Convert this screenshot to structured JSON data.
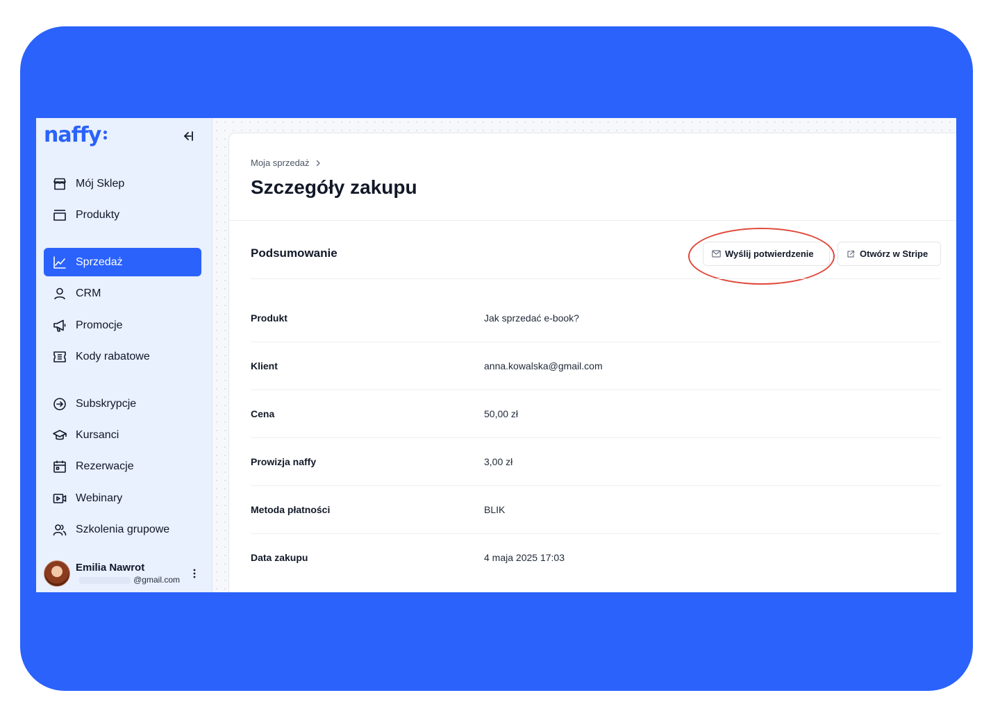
{
  "brand": {
    "logo_text": "naffy",
    "accent": "#2a62fb",
    "highlight": "#e0473a"
  },
  "sidebar": {
    "collapse_icon": "collapse-left-icon",
    "items": [
      {
        "label": "Mój Sklep",
        "icon": "store-icon",
        "active": false
      },
      {
        "label": "Produkty",
        "icon": "folder-icon",
        "active": false
      },
      {
        "label": "Sprzedaż",
        "icon": "chart-line-icon",
        "active": true
      },
      {
        "label": "CRM",
        "icon": "user-icon",
        "active": false
      },
      {
        "label": "Promocje",
        "icon": "megaphone-icon",
        "active": false
      },
      {
        "label": "Kody rabatowe",
        "icon": "ticket-icon",
        "active": false
      },
      {
        "label": "Subskrypcje",
        "icon": "subscription-icon",
        "active": false
      },
      {
        "label": "Kursanci",
        "icon": "graduation-cap-icon",
        "active": false
      },
      {
        "label": "Rezerwacje",
        "icon": "calendar-icon",
        "active": false
      },
      {
        "label": "Webinary",
        "icon": "video-icon",
        "active": false
      },
      {
        "label": "Szkolenia grupowe",
        "icon": "users-icon",
        "active": false
      }
    ],
    "user": {
      "name": "Emilia Nawrot",
      "email": "@gmail.com"
    }
  },
  "main": {
    "breadcrumb": "Moja sprzedaż",
    "title": "Szczegóły zakupu",
    "section_title": "Podsumowanie",
    "actions": {
      "send_confirmation": "Wyślij potwierdzenie",
      "open_stripe": "Otwórz w Stripe"
    },
    "details": [
      {
        "label": "Produkt",
        "value": "Jak sprzedać e-book?"
      },
      {
        "label": "Klient",
        "value": "anna.kowalska@gmail.com"
      },
      {
        "label": "Cena",
        "value": "50,00 zł"
      },
      {
        "label": "Prowizja naffy",
        "value": "3,00 zł"
      },
      {
        "label": "Metoda płatności",
        "value": "BLIK"
      },
      {
        "label": "Data zakupu",
        "value": "4 maja 2025 17:03"
      }
    ]
  }
}
